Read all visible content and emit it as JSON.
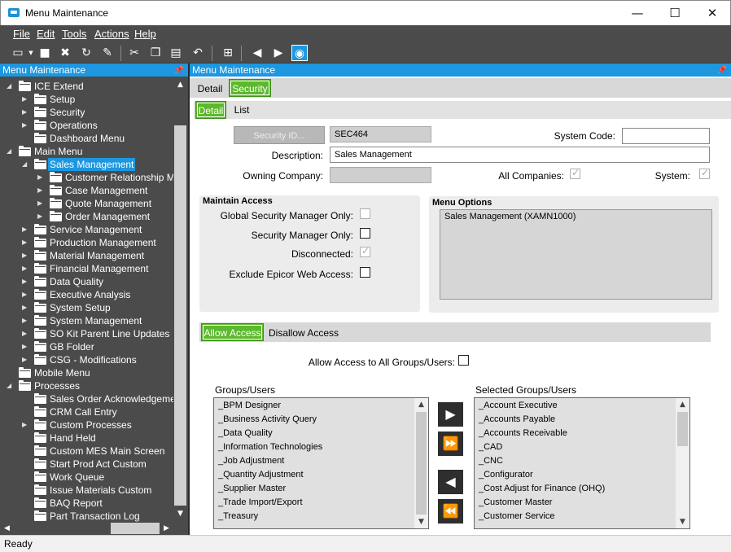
{
  "window": {
    "title": "Menu Maintenance",
    "minimize": "—",
    "maximize": "☐",
    "close": "✕"
  },
  "menubar": {
    "file": "File",
    "edit": "Edit",
    "tools": "Tools",
    "actions": "Actions",
    "help": "Help"
  },
  "toolbar": {
    "icons": [
      "new-icon",
      "save-icon",
      "delete-icon",
      "refresh-icon",
      "clear-icon",
      "cut-icon",
      "copy-icon",
      "paste-icon",
      "undo-icon",
      "binoculars-icon",
      "back-icon",
      "forward-icon",
      "home-icon"
    ]
  },
  "left_panel": {
    "title": "Menu Maintenance",
    "tree": [
      {
        "label": "ICE Extend",
        "level": 0,
        "exp": "◢"
      },
      {
        "label": "Setup",
        "level": 1,
        "exp": "▶"
      },
      {
        "label": "Security",
        "level": 1,
        "exp": "▶"
      },
      {
        "label": "Operations",
        "level": 1,
        "exp": "▶"
      },
      {
        "label": "Dashboard Menu",
        "level": 1,
        "exp": ""
      },
      {
        "label": "Main Menu",
        "level": 0,
        "exp": "◢"
      },
      {
        "label": "Sales Management",
        "level": 1,
        "exp": "◢",
        "selected": true
      },
      {
        "label": "Customer Relationship M",
        "level": 2,
        "exp": "▶"
      },
      {
        "label": "Case Management",
        "level": 2,
        "exp": "▶"
      },
      {
        "label": "Quote Management",
        "level": 2,
        "exp": "▶"
      },
      {
        "label": "Order Management",
        "level": 2,
        "exp": "▶"
      },
      {
        "label": "Service Management",
        "level": 1,
        "exp": "▶"
      },
      {
        "label": "Production Management",
        "level": 1,
        "exp": "▶"
      },
      {
        "label": "Material Management",
        "level": 1,
        "exp": "▶"
      },
      {
        "label": "Financial Management",
        "level": 1,
        "exp": "▶"
      },
      {
        "label": "Data Quality",
        "level": 1,
        "exp": "▶"
      },
      {
        "label": "Executive Analysis",
        "level": 1,
        "exp": "▶"
      },
      {
        "label": "System Setup",
        "level": 1,
        "exp": "▶"
      },
      {
        "label": "System Management",
        "level": 1,
        "exp": "▶"
      },
      {
        "label": "SO Kit Parent Line Updates",
        "level": 1,
        "exp": "▶"
      },
      {
        "label": "GB Folder",
        "level": 1,
        "exp": "▶"
      },
      {
        "label": "CSG - Modifications",
        "level": 1,
        "exp": "▶"
      },
      {
        "label": "Mobile Menu",
        "level": 0,
        "exp": ""
      },
      {
        "label": "Processes",
        "level": 0,
        "exp": "◢"
      },
      {
        "label": "Sales Order Acknowledgeme",
        "level": 1,
        "exp": ""
      },
      {
        "label": "CRM Call Entry",
        "level": 1,
        "exp": ""
      },
      {
        "label": "Custom Processes",
        "level": 1,
        "exp": "▶"
      },
      {
        "label": "Hand Held",
        "level": 1,
        "exp": ""
      },
      {
        "label": "Custom MES Main Screen",
        "level": 1,
        "exp": ""
      },
      {
        "label": "Start Prod Act Custom",
        "level": 1,
        "exp": ""
      },
      {
        "label": "Work Queue",
        "level": 1,
        "exp": ""
      },
      {
        "label": "Issue Materials Custom",
        "level": 1,
        "exp": ""
      },
      {
        "label": "BAQ Report",
        "level": 1,
        "exp": ""
      },
      {
        "label": "Part Transaction Log",
        "level": 1,
        "exp": ""
      }
    ]
  },
  "right_panel": {
    "title": "Menu Maintenance",
    "tabs_top": {
      "detail": "Detail",
      "security": "Security"
    },
    "tabs_sub": {
      "detail": "Detail",
      "list": "List"
    },
    "security_id_button": "Security ID...",
    "security_id_value": "SEC464",
    "system_code_label": "System Code:",
    "system_code_value": "",
    "description_label": "Description:",
    "description_value": "Sales Management",
    "owning_company_label": "Owning Company:",
    "owning_company_value": "",
    "all_companies_label": "All Companies:",
    "system_label": "System:",
    "maintain_access": {
      "title": "Maintain Access",
      "global_security": "Global Security Manager Only:",
      "security_manager": "Security Manager Only:",
      "disconnected": "Disconnected:",
      "exclude_web": "Exclude Epicor Web Access:"
    },
    "menu_options": {
      "title": "Menu Options",
      "items": [
        "Sales Management (XAMN1000)"
      ]
    },
    "access_tabs": {
      "allow": "Allow Access",
      "disallow": "Disallow Access"
    },
    "allow_all_label": "Allow Access to All Groups/Users:",
    "groups_label": "Groups/Users",
    "groups": [
      "_BPM Designer",
      "_Business Activity Query",
      "_Data Quality",
      "_Information Technologies",
      "_Job Adjustment",
      "_Quantity Adjustment",
      "_Supplier Master",
      "_Trade Import/Export",
      "_Treasury"
    ],
    "selected_label": "Selected Groups/Users",
    "selected": [
      "_Account Executive",
      "_Accounts Payable",
      "_Accounts Receivable",
      "_CAD",
      "_CNC",
      "_Configurator",
      "_Cost Adjust for Finance (OHQ)",
      "_Customer Master",
      "_Customer Service"
    ]
  },
  "status": "Ready"
}
